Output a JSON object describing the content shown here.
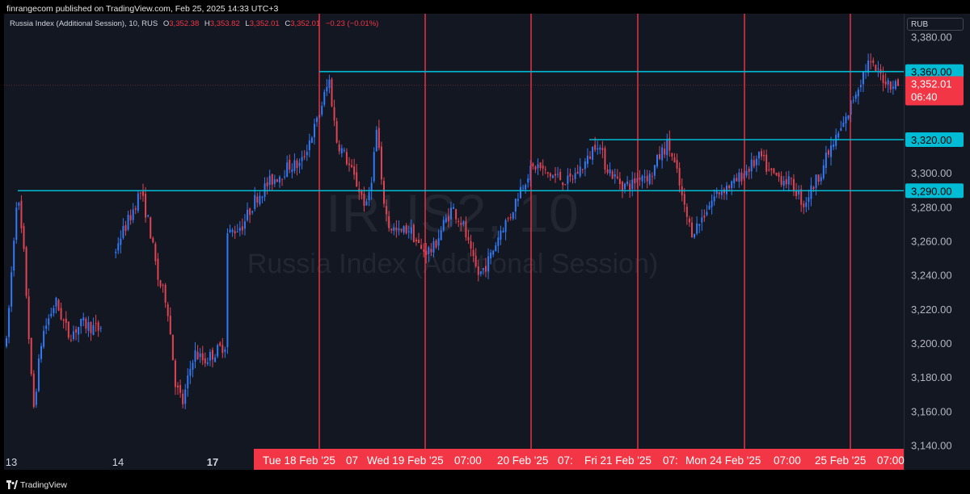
{
  "header": {
    "published": "finrangecom published on TradingView.com, Feb 25, 2025 14:33 UTC+3"
  },
  "legend": {
    "symbol": "Russia Index (Additional Session), 10, RUS",
    "open_label": "O",
    "open": "3,352.38",
    "high_label": "H",
    "high": "3,353.82",
    "low_label": "L",
    "low": "3,352.01",
    "close_label": "C",
    "close": "3,352.01",
    "change": "−0.23 (−0.01%)"
  },
  "currency": "RUB",
  "watermark": {
    "ticker": "IRUS2, 10",
    "name": "Russia Index (Additional Session)"
  },
  "footer": {
    "brand": "TradingView"
  },
  "colors": {
    "background": "#131722",
    "up": "#3179f5",
    "down": "#e04452",
    "level": "#00bcd4",
    "vline": "#f23645",
    "date_bar": "#f23645"
  },
  "chart_data": {
    "type": "candlestick",
    "ylim": [
      3126,
      3394
    ],
    "y_ticks": [
      {
        "value": 3380,
        "label": "3,380.00"
      },
      {
        "value": 3300,
        "label": "3,300.00"
      },
      {
        "value": 3280,
        "label": "3,280.00"
      },
      {
        "value": 3260,
        "label": "3,260.00"
      },
      {
        "value": 3240,
        "label": "3,240.00"
      },
      {
        "value": 3220,
        "label": "3,220.00"
      },
      {
        "value": 3200,
        "label": "3,200.00"
      },
      {
        "value": 3180,
        "label": "3,180.00"
      },
      {
        "value": 3160,
        "label": "3,160.00"
      },
      {
        "value": 3140,
        "label": "3,140.00"
      }
    ],
    "x_ticks": [
      "13",
      "14",
      "17"
    ],
    "x_tick_bold": [
      false,
      false,
      true
    ],
    "date_labels": [
      "Tue 18 Feb '25",
      "07",
      "Wed 19 Feb '25",
      "07:00",
      "20 Feb '25",
      "07:",
      "Fri 21 Feb '25",
      "07:",
      "Mon 24 Feb '25",
      "07:00",
      "25 Feb '25",
      "07:00"
    ],
    "levels": [
      {
        "value": 3360,
        "label": "3,360.00",
        "start": "Tue 18 Feb '25"
      },
      {
        "value": 3320,
        "label": "3,320.00",
        "start": "Fri 21 Feb '25"
      },
      {
        "value": 3290,
        "label": "3,290.00",
        "start": "13"
      }
    ],
    "last_price": {
      "label": "3,352.01",
      "countdown": "06:40",
      "value": 3352.01
    },
    "vertical_lines": [
      "Tue 18 Feb '25",
      "Wed 19 Feb '25",
      "20 Feb '25",
      "Fri 21 Feb '25",
      "Mon 24 Feb '25",
      "25 Feb '25"
    ],
    "path": [
      [
        0.0,
        3200
      ],
      [
        0.012,
        3290
      ],
      [
        0.02,
        3250
      ],
      [
        0.03,
        3160
      ],
      [
        0.04,
        3205
      ],
      [
        0.055,
        3225
      ],
      [
        0.07,
        3205
      ],
      [
        0.085,
        3212
      ],
      [
        0.095,
        3210
      ],
      [
        0.105,
        3208
      ],
      [
        0.125,
        3260
      ],
      [
        0.14,
        3276
      ],
      [
        0.15,
        3290
      ],
      [
        0.16,
        3270
      ],
      [
        0.17,
        3238
      ],
      [
        0.18,
        3225
      ],
      [
        0.19,
        3175
      ],
      [
        0.198,
        3165
      ],
      [
        0.21,
        3195
      ],
      [
        0.222,
        3190
      ],
      [
        0.234,
        3195
      ],
      [
        0.246,
        3200
      ],
      [
        0.235,
        3262
      ],
      [
        0.25,
        3265
      ],
      [
        0.265,
        3270
      ],
      [
        0.28,
        3286
      ],
      [
        0.295,
        3295
      ],
      [
        0.308,
        3300
      ],
      [
        0.318,
        3305
      ],
      [
        0.33,
        3305
      ],
      [
        0.34,
        3320
      ],
      [
        0.348,
        3330
      ],
      [
        0.356,
        3345
      ],
      [
        0.362,
        3355
      ],
      [
        0.37,
        3320
      ],
      [
        0.38,
        3310
      ],
      [
        0.388,
        3300
      ],
      [
        0.396,
        3290
      ],
      [
        0.404,
        3280
      ],
      [
        0.41,
        3300
      ],
      [
        0.416,
        3330
      ],
      [
        0.42,
        3295
      ],
      [
        0.428,
        3270
      ],
      [
        0.44,
        3265
      ],
      [
        0.452,
        3268
      ],
      [
        0.465,
        3255
      ],
      [
        0.478,
        3255
      ],
      [
        0.49,
        3270
      ],
      [
        0.5,
        3280
      ],
      [
        0.512,
        3270
      ],
      [
        0.522,
        3250
      ],
      [
        0.53,
        3240
      ],
      [
        0.542,
        3250
      ],
      [
        0.555,
        3268
      ],
      [
        0.565,
        3275
      ],
      [
        0.575,
        3290
      ],
      [
        0.585,
        3300
      ],
      [
        0.595,
        3305
      ],
      [
        0.605,
        3300
      ],
      [
        0.618,
        3298
      ],
      [
        0.63,
        3295
      ],
      [
        0.642,
        3302
      ],
      [
        0.652,
        3308
      ],
      [
        0.662,
        3320
      ],
      [
        0.672,
        3305
      ],
      [
        0.682,
        3298
      ],
      [
        0.692,
        3293
      ],
      [
        0.702,
        3294
      ],
      [
        0.712,
        3300
      ],
      [
        0.722,
        3298
      ],
      [
        0.732,
        3310
      ],
      [
        0.742,
        3318
      ],
      [
        0.752,
        3300
      ],
      [
        0.76,
        3280
      ],
      [
        0.768,
        3266
      ],
      [
        0.776,
        3270
      ],
      [
        0.786,
        3280
      ],
      [
        0.796,
        3288
      ],
      [
        0.806,
        3292
      ],
      [
        0.816,
        3294
      ],
      [
        0.826,
        3300
      ],
      [
        0.836,
        3305
      ],
      [
        0.846,
        3310
      ],
      [
        0.856,
        3300
      ],
      [
        0.866,
        3298
      ],
      [
        0.876,
        3296
      ],
      [
        0.886,
        3290
      ],
      [
        0.894,
        3282
      ],
      [
        0.902,
        3290
      ],
      [
        0.912,
        3300
      ],
      [
        0.922,
        3312
      ],
      [
        0.932,
        3322
      ],
      [
        0.942,
        3332
      ],
      [
        0.95,
        3345
      ],
      [
        0.958,
        3355
      ],
      [
        0.966,
        3365
      ],
      [
        0.976,
        3360
      ],
      [
        0.988,
        3354
      ],
      [
        0.998,
        3352
      ]
    ]
  }
}
